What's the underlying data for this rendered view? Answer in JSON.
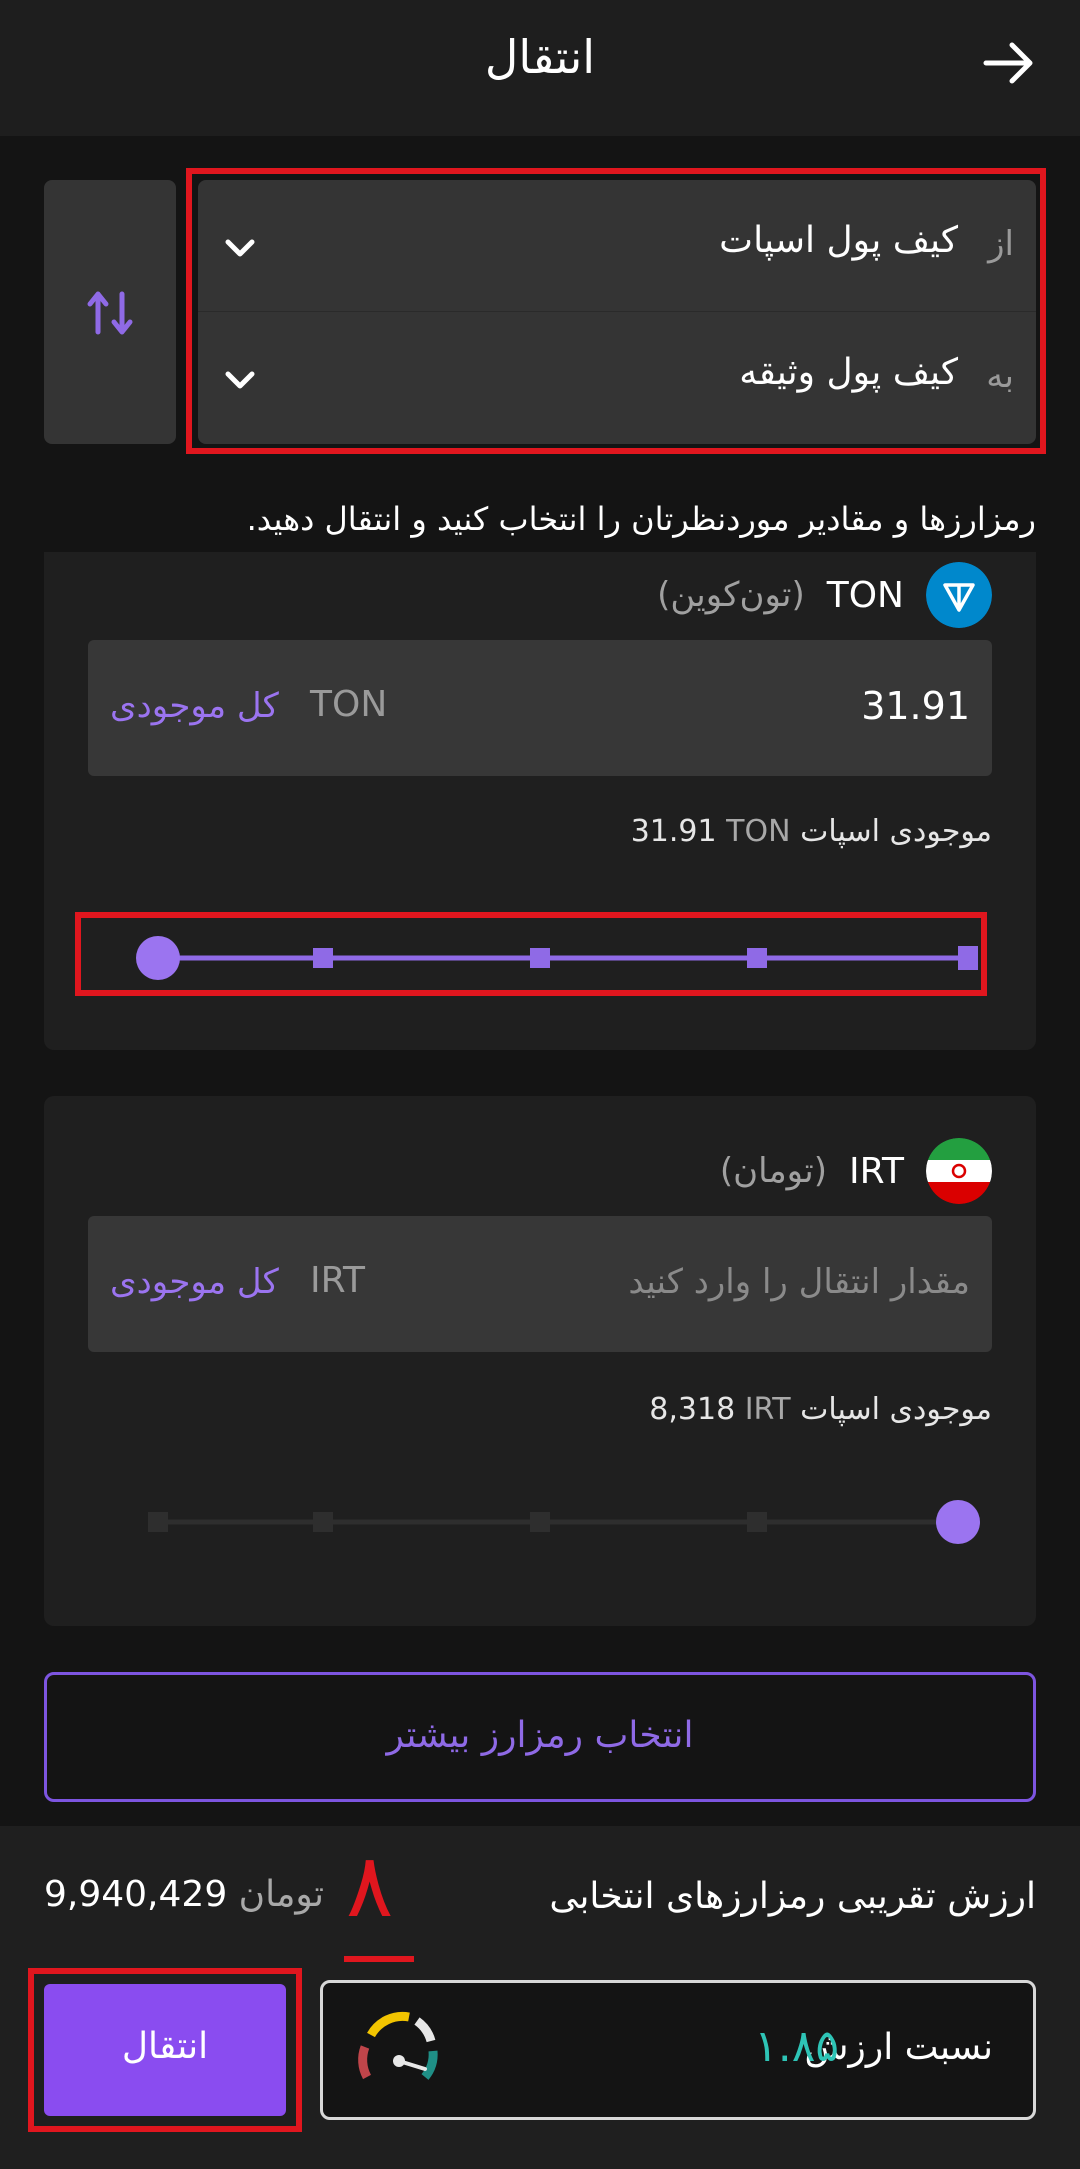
{
  "header": {
    "title": "انتقال"
  },
  "wallets": {
    "from_prefix": "از",
    "from_name": "کیف پول اسپات",
    "to_prefix": "به",
    "to_name": "کیف پول وثیقه"
  },
  "hint": "رمزارزها و مقادیر موردنظرتان را انتخاب کنید و انتقال دهید.",
  "assets": [
    {
      "symbol": "TON",
      "name": "(تون‌کوین)",
      "amount": "31.91",
      "unit": "TON",
      "all_label": "کل موجودی",
      "balance_label": "موجودی اسپات",
      "balance_value": "31.91",
      "balance_unit": "TON",
      "slider_fraction": 0
    },
    {
      "symbol": "IRT",
      "name": "(تومان)",
      "placeholder": "مقدار انتقال را وارد کنید",
      "unit": "IRT",
      "all_label": "کل موجودی",
      "balance_label": "موجودی اسپات",
      "balance_value": "8,318",
      "balance_unit": "IRT",
      "slider_fraction": 1
    }
  ],
  "more_button": "انتخاب رمزارز بیشتر",
  "footer": {
    "estimate_label": "ارزش تقریبی رمزارزهای انتخابی",
    "estimate_value": "9,940,429",
    "estimate_unit": "تومان",
    "ratio_label": "نسبت ارزش",
    "ratio_value": "۱.۸۵",
    "transfer_button": "انتقال"
  },
  "annotation": {
    "number": "٨"
  },
  "colors": {
    "accent": "#8a4cf0",
    "ratio_value": "#2ec4b6",
    "highlight": "#e0161e"
  },
  "icons": {
    "back": "arrow-right-icon",
    "chevron": "chevron-down-icon",
    "swap": "swap-vertical-icon",
    "ton": "ton-logo-icon",
    "irt": "iran-flag-icon",
    "gauge": "gauge-icon"
  }
}
